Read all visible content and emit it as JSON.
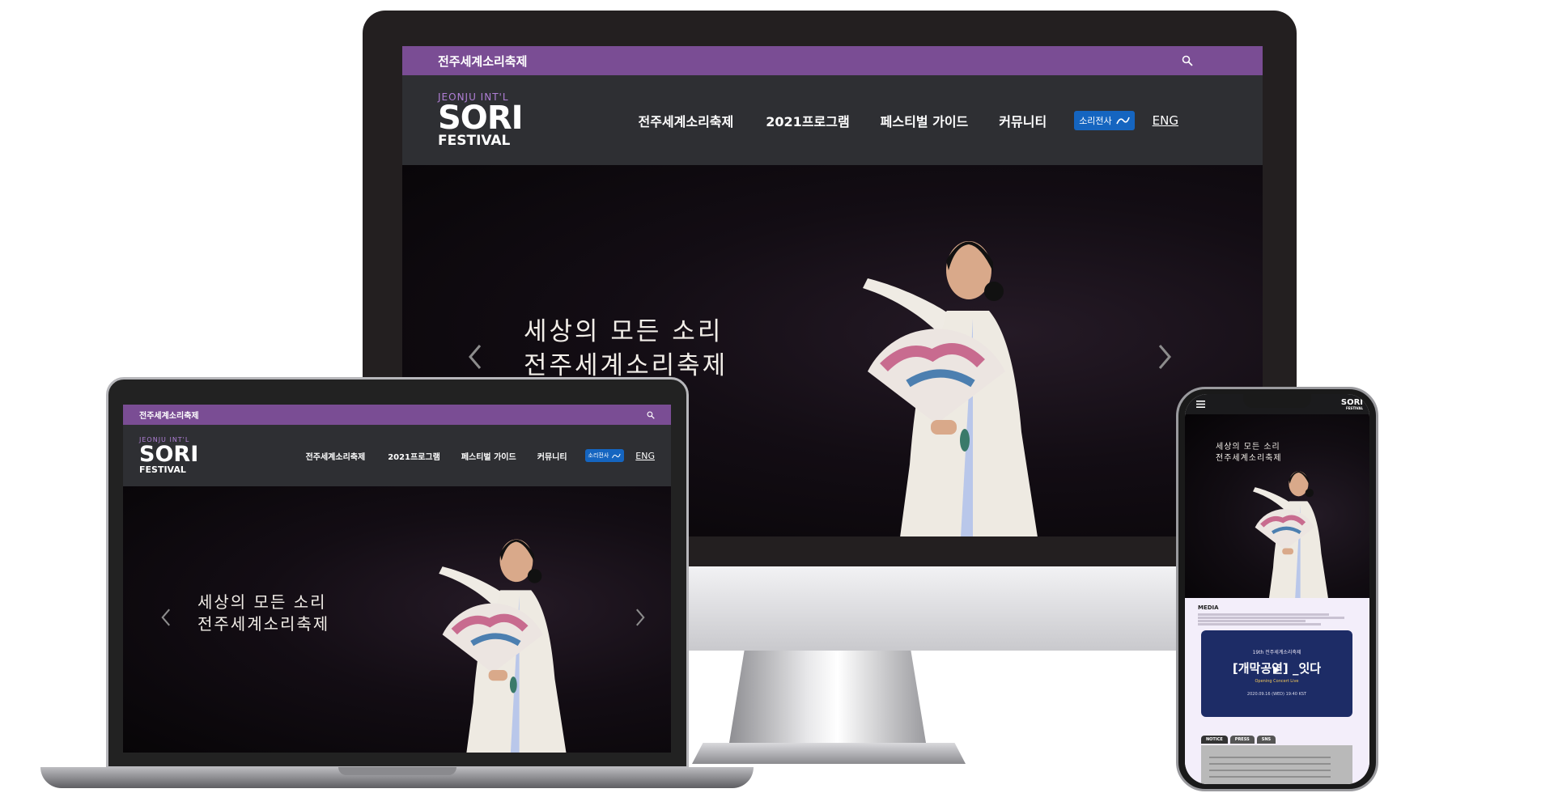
{
  "site": {
    "name": "전주세계소리축제",
    "logo": {
      "line1": "JEONJU INT'L",
      "line2": "SORI",
      "line3": "FESTIVAL"
    }
  },
  "nav": {
    "items": [
      "전주세계소리축제",
      "2021프로그램",
      "페스티벌 가이드",
      "커뮤니티"
    ],
    "badge": "소리전사",
    "lang": "ENG"
  },
  "hero": {
    "line1": "세상의 모든 소리",
    "line2": "전주세계소리축제",
    "prev_icon": "chevron-left-icon",
    "next_icon": "chevron-right-icon"
  },
  "icons": {
    "search": "search-icon",
    "menu": "hamburger-icon"
  },
  "mobile": {
    "media_title": "MEDIA",
    "video_sub": "19th 전주세계소리축제",
    "video_title": "[개막공연] _잇다",
    "video_label": "Opening Concert Live",
    "video_date": "2020.09.16 (WED) 19:40 KST",
    "tabs": [
      "NOTICE",
      "PRESS",
      "SNS"
    ]
  },
  "colors": {
    "topbar": "#7a4d94",
    "navbar": "#2e2f33",
    "badge": "#1565c0",
    "logo_accent": "#b07fd6",
    "hero_bg": "#0d0b0d"
  }
}
